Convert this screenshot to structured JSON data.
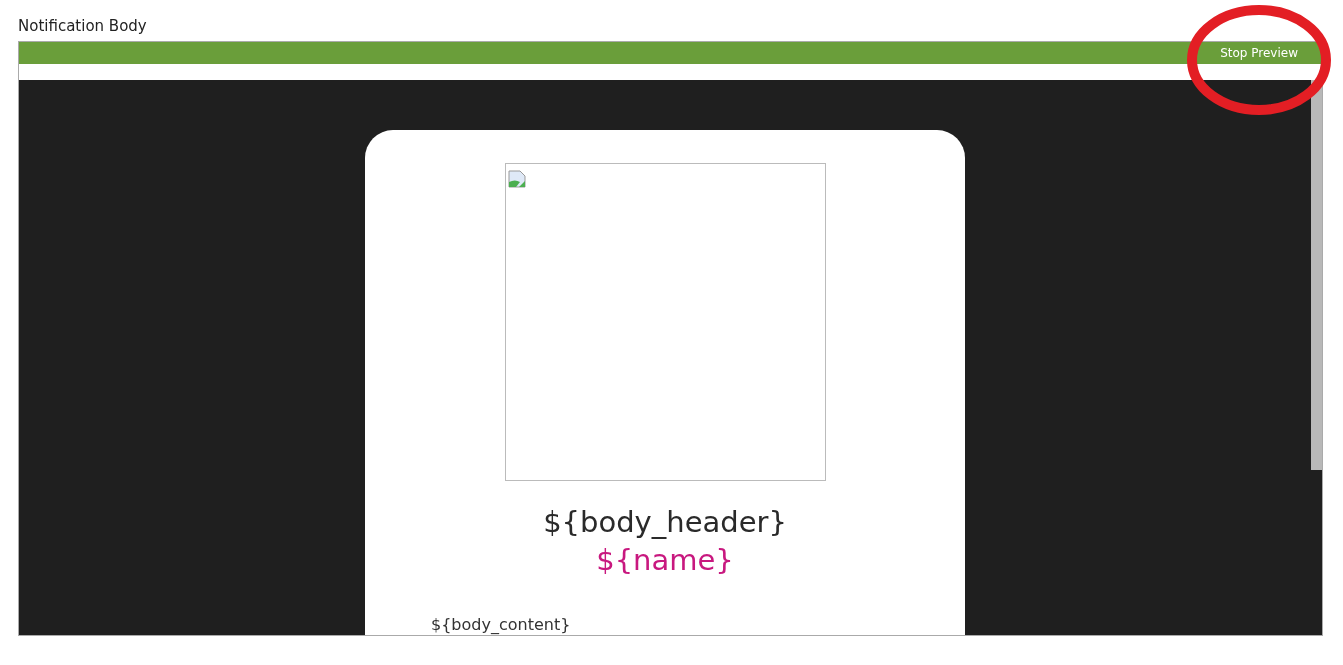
{
  "field_label": "Notification Body",
  "toolbar": {
    "button": "Stop Preview"
  },
  "preview": {
    "header": "${body_header}",
    "name": "${name}",
    "content": "${body_content}"
  }
}
